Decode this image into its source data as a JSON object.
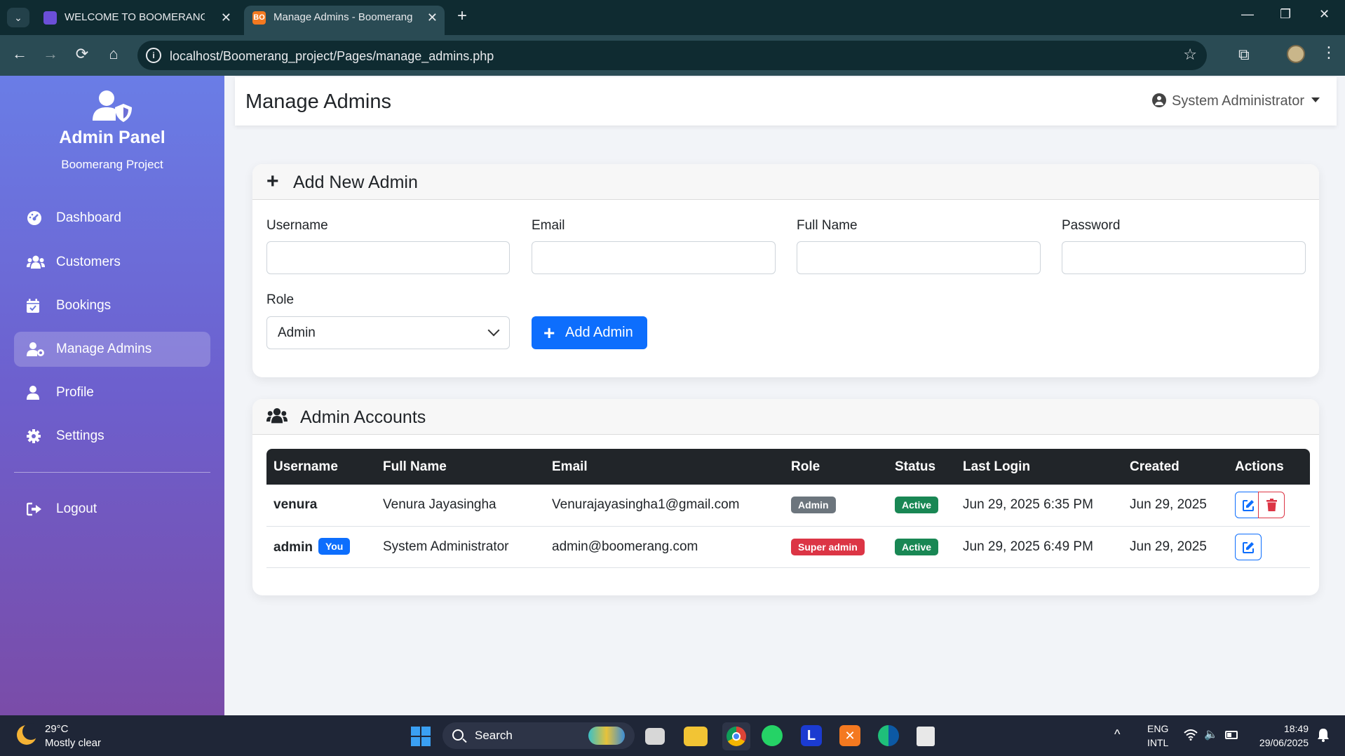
{
  "browser": {
    "tabs": [
      {
        "title": "WELCOME TO BOOMERANG SC",
        "active": false
      },
      {
        "title": "Manage Admins - Boomerang F",
        "active": true
      }
    ],
    "favicon2_glyph": "BO",
    "url": "localhost/Boomerang_project/Pages/manage_admins.php",
    "icons": {
      "new_tab": "+",
      "minimize": "—",
      "maximize": "❐",
      "close": "✕",
      "back": "←",
      "forward": "→",
      "reload": "⟳",
      "home": "⌂",
      "star": "☆",
      "extensions": "⧉",
      "menu": "⋮",
      "tab_close": "✕",
      "tab_list": "⌄"
    }
  },
  "sidebar": {
    "title": "Admin Panel",
    "subtitle": "Boomerang Project",
    "items": [
      {
        "label": "Dashboard",
        "icon": "gauge-icon",
        "active": false
      },
      {
        "label": "Customers",
        "icon": "users-icon",
        "active": false
      },
      {
        "label": "Bookings",
        "icon": "calendar-check-icon",
        "active": false
      },
      {
        "label": "Manage Admins",
        "icon": "user-shield-icon",
        "active": true
      },
      {
        "label": "Profile",
        "icon": "user-icon",
        "active": false
      },
      {
        "label": "Settings",
        "icon": "gear-icon",
        "active": false
      },
      {
        "label": "Logout",
        "icon": "sign-out-icon",
        "active": false
      }
    ]
  },
  "header": {
    "title": "Manage Admins",
    "user": "System Administrator"
  },
  "add_form": {
    "title": "Add New Admin",
    "labels": {
      "username": "Username",
      "email": "Email",
      "full_name": "Full Name",
      "password": "Password",
      "role": "Role"
    },
    "values": {
      "username": "",
      "email": "",
      "full_name": "",
      "password": ""
    },
    "role_selected": "Admin",
    "submit_label": "Add Admin"
  },
  "accounts": {
    "title": "Admin Accounts",
    "columns": [
      "Username",
      "Full Name",
      "Email",
      "Role",
      "Status",
      "Last Login",
      "Created",
      "Actions"
    ],
    "rows": [
      {
        "username": "venura",
        "you_badge": "",
        "full_name": "Venura Jayasingha",
        "email": "Venurajayasingha1@gmail.com",
        "role": "Admin",
        "status": "Active",
        "last_login": "Jun 29, 2025 6:35 PM",
        "created": "Jun 29, 2025"
      },
      {
        "username": "admin",
        "you_badge": "You",
        "full_name": "System Administrator",
        "email": "admin@boomerang.com",
        "role": "Super admin",
        "status": "Active",
        "last_login": "Jun 29, 2025 6:49 PM",
        "created": "Jun 29, 2025"
      }
    ]
  },
  "colors": {
    "primary": "#0d6efd",
    "danger": "#dc3545",
    "success": "#198754",
    "secondary": "#6c757d",
    "sidebar_gradient_top": "#6a7de6",
    "sidebar_gradient_bottom": "#7a4ca8"
  },
  "taskbar": {
    "weather_temp": "29°C",
    "weather_desc": "Mostly clear",
    "search_label": "Search",
    "lang_top": "ENG",
    "lang_bottom": "INTL",
    "time": "18:49",
    "date": "29/06/2025",
    "app_glyphs": {
      "l_app": "L",
      "xampp": "✕"
    },
    "icons": {
      "tray_expand": "^",
      "wifi": "wifi-icon",
      "volume": "🔈",
      "battery": "battery-icon",
      "notifications": "bell-icon"
    }
  }
}
